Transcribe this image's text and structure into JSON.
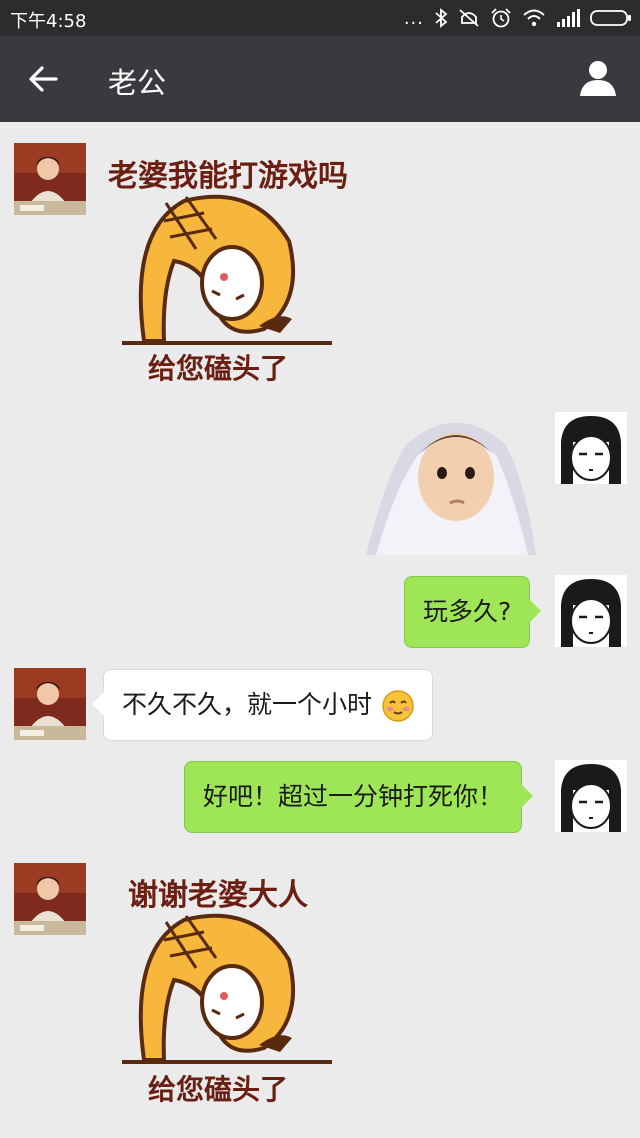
{
  "status": {
    "time": "下午4:58",
    "dots": "..."
  },
  "header": {
    "title": "老公"
  },
  "messages": {
    "m1_text": "老婆我能打游戏吗",
    "m1_caption": "给您磕头了",
    "m3_text": "玩多久?",
    "m4_text": "不久不久，就一个小时",
    "m5_text": "好吧！超过一分钟打死你！",
    "m6_text": "谢谢老婆大人",
    "m6_caption": "给您磕头了"
  },
  "colors": {
    "status_bar": "#2c2c2c",
    "title_bar": "#393a3f",
    "chat_bg": "#ebebeb",
    "sent_bubble": "#9fe657",
    "received_bubble": "#ffffff",
    "sticker_text": "#6b1f12",
    "sticker_yellow": "#f6b73c"
  },
  "icons": {
    "back": "arrow-left-icon",
    "profile": "person-icon",
    "emoji": "blush-face-emoji"
  }
}
